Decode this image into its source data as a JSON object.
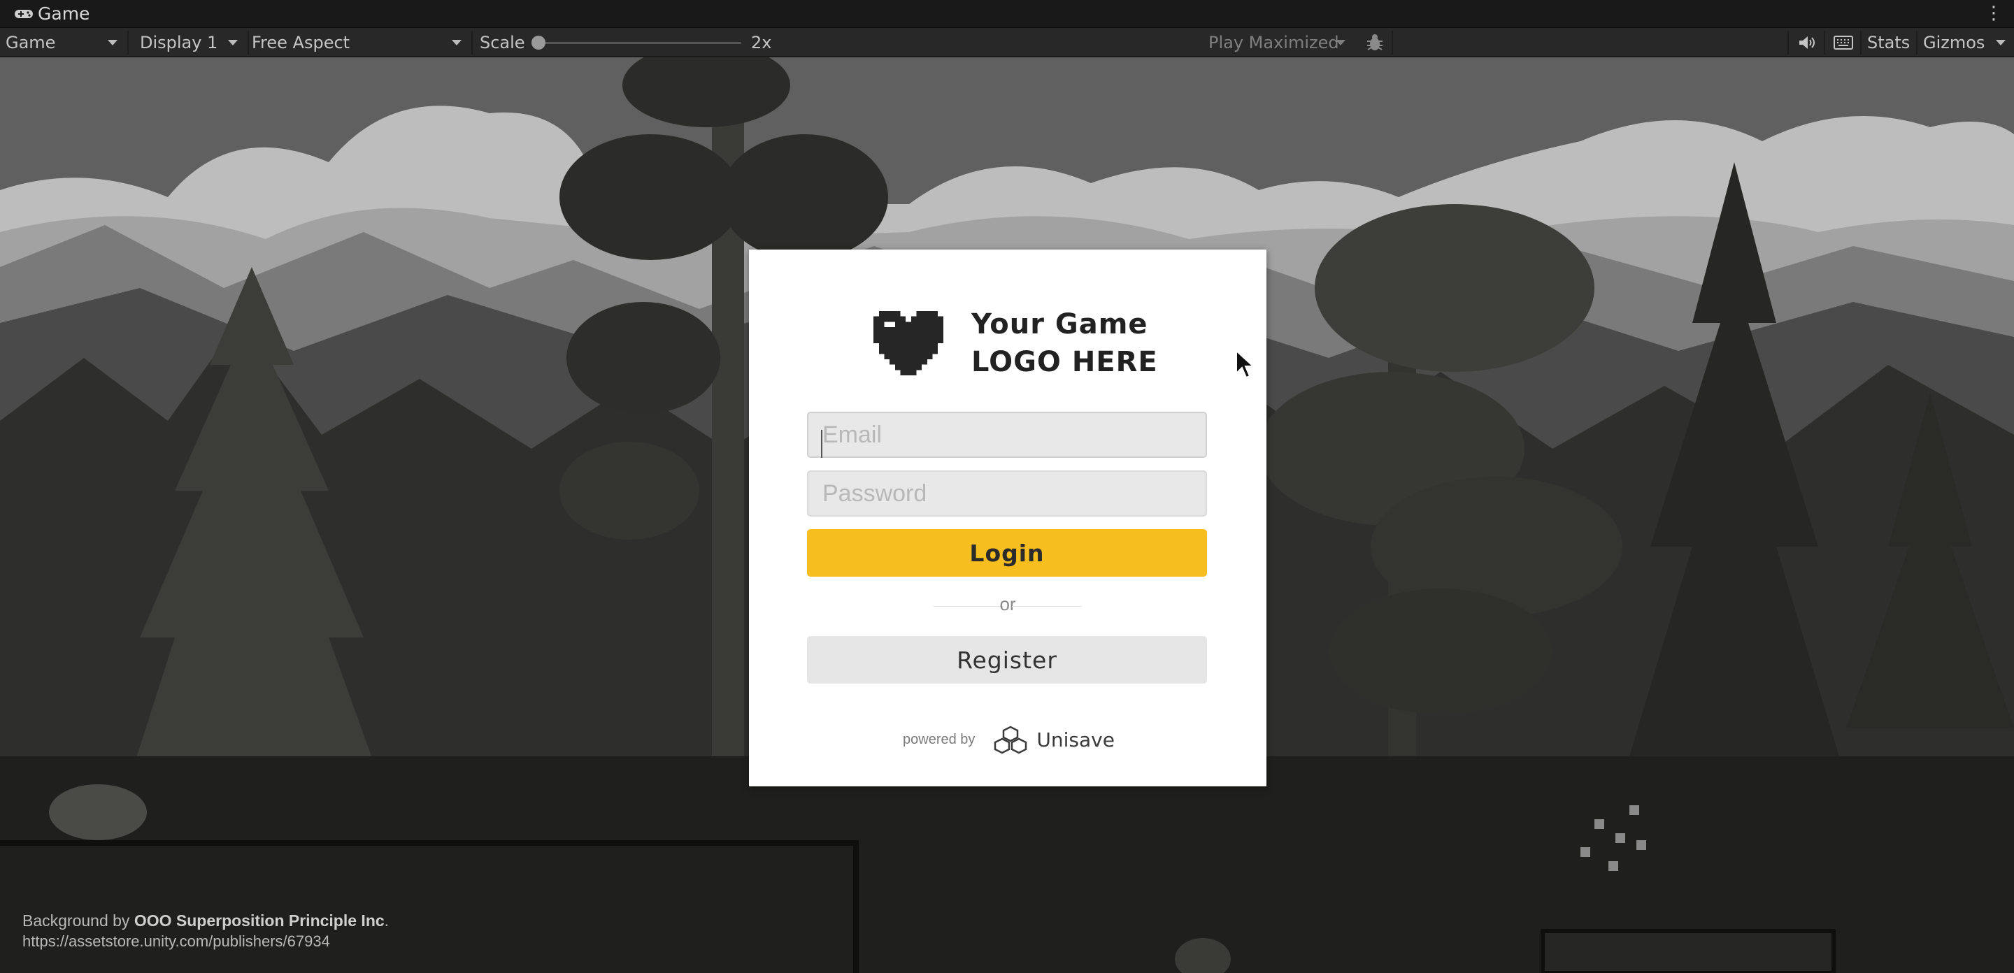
{
  "window": {
    "tab_title": "Game",
    "menu_icon": "kebab-menu-icon"
  },
  "toolbar": {
    "view_select": "Game",
    "display_select": "Display 1",
    "aspect_select": "Free Aspect",
    "scale_label": "Scale",
    "scale_value": "2x",
    "scale_fraction": 0.0,
    "play_mode_select": "Play Maximized",
    "debug_icon": "bug-icon",
    "audio_icon": "speaker-icon",
    "keyboard_icon": "keyboard-icon",
    "stats_label": "Stats",
    "gizmos_label": "Gizmos"
  },
  "login": {
    "logo_line1": "Your Game",
    "logo_line2": "LOGO HERE",
    "logo_icon": "pixel-heart-icon",
    "email_placeholder": "Email",
    "password_placeholder": "Password",
    "login_label": "Login",
    "divider_text": "or",
    "register_label": "Register",
    "powered_by": "powered by",
    "brand_name": "Unisave",
    "brand_icon": "unisave-cubes-icon"
  },
  "credit": {
    "prefix": "Background by",
    "author": "OOO Superposition Principle Inc",
    "suffix": ".",
    "url": "https://assetstore.unity.com/publishers/67934"
  },
  "colors": {
    "accent": "#f7be20",
    "panel": "#ffffff",
    "field": "#e8e8e8",
    "toolbar": "#282828"
  }
}
